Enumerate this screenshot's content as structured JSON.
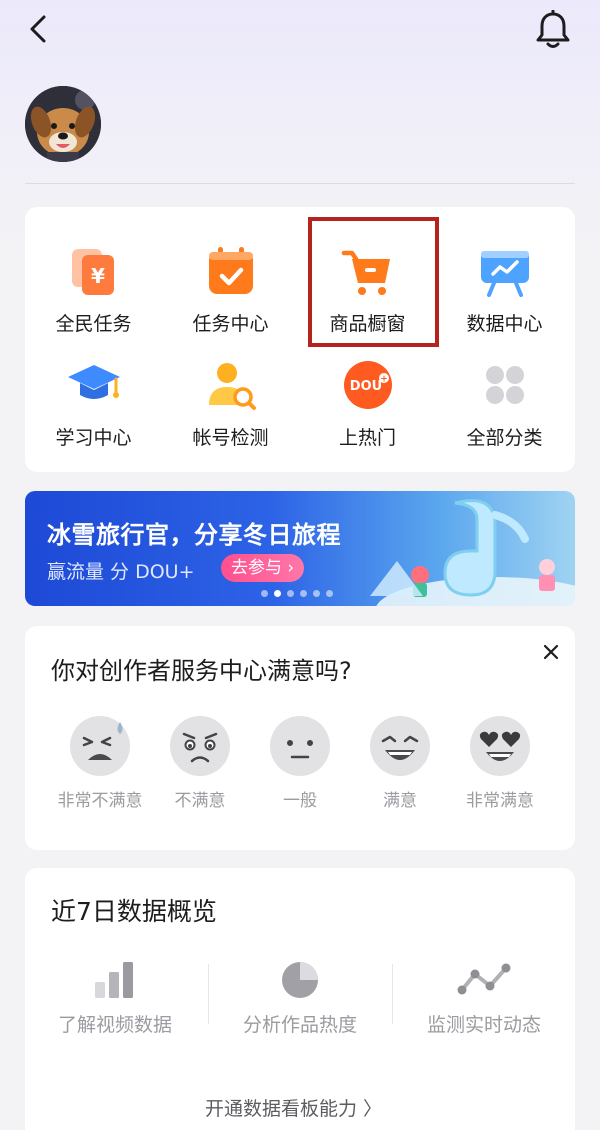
{
  "grid": {
    "items": [
      {
        "label": "全民任务",
        "icon": "coupon-yen-icon"
      },
      {
        "label": "任务中心",
        "icon": "calendar-check-icon"
      },
      {
        "label": "商品橱窗",
        "icon": "shopping-cart-icon"
      },
      {
        "label": "数据中心",
        "icon": "presentation-board-icon"
      },
      {
        "label": "学习中心",
        "icon": "graduation-cap-icon"
      },
      {
        "label": "帐号检测",
        "icon": "user-search-icon"
      },
      {
        "label": "上热门",
        "icon": "dou-plus-icon"
      },
      {
        "label": "全部分类",
        "icon": "four-dots-icon"
      }
    ],
    "highlighted": "商品橱窗"
  },
  "banner": {
    "title": "冰雪旅行官，分享冬日旅程",
    "subtitle": "赢流量 分 DOU+",
    "cta": "去参与 ›",
    "active_dot": 1,
    "dot_count": 6
  },
  "survey": {
    "question": "你对创作者服务中心满意吗?",
    "options": [
      {
        "label": "非常不满意",
        "icon": "very-unsatisfied-face-icon"
      },
      {
        "label": "不满意",
        "icon": "unsatisfied-face-icon"
      },
      {
        "label": "一般",
        "icon": "neutral-face-icon"
      },
      {
        "label": "满意",
        "icon": "satisfied-face-icon"
      },
      {
        "label": "非常满意",
        "icon": "very-satisfied-face-icon"
      }
    ]
  },
  "overview": {
    "title": "近7日数据概览",
    "items": [
      {
        "label": "了解视频数据",
        "icon": "bar-chart-icon"
      },
      {
        "label": "分析作品热度",
        "icon": "pie-chart-icon"
      },
      {
        "label": "监测实时动态",
        "icon": "line-trend-icon"
      }
    ],
    "open_link": "开通数据看板能力 〉"
  },
  "colors": {
    "accent_orange": "#ff7a1a",
    "highlight_red": "#b5231f",
    "banner_blue": "#2d63e6",
    "cta_pink": "#ff5d96"
  }
}
